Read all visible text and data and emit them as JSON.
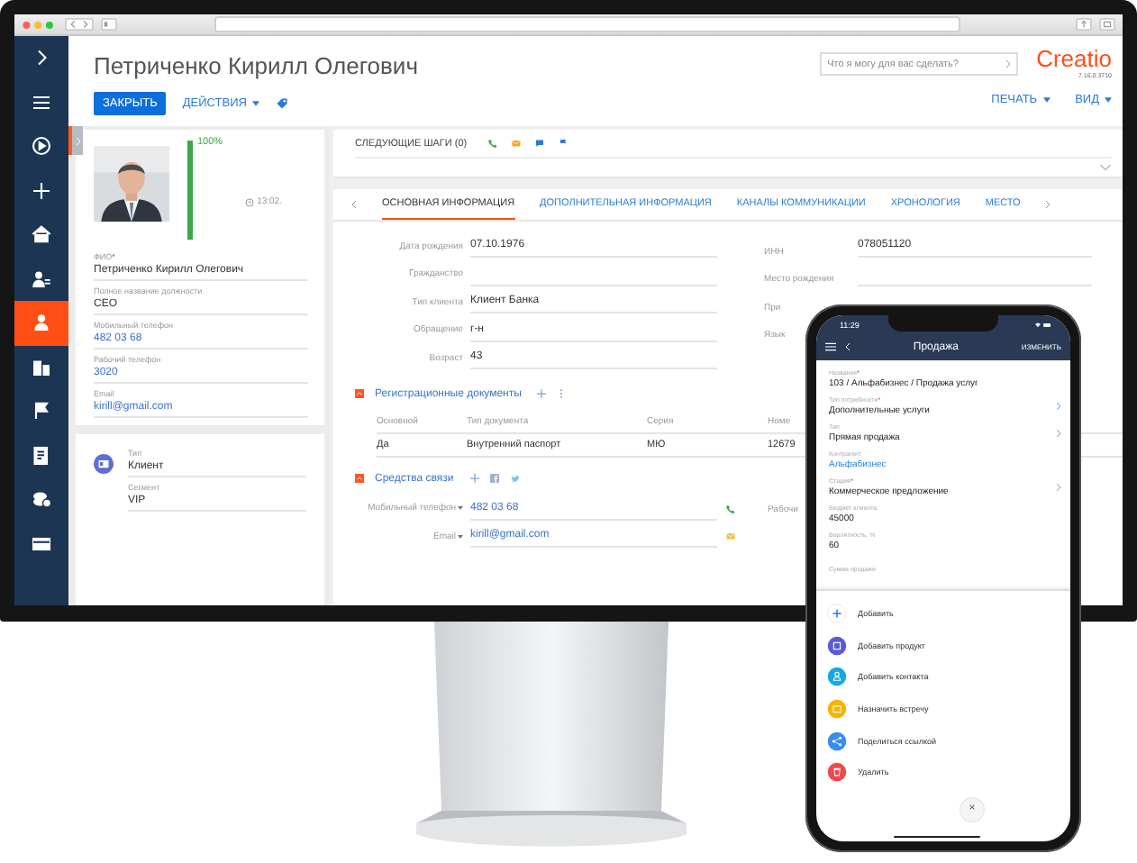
{
  "sidebar": {
    "items": [
      {
        "kind": "expand",
        "selected": false
      },
      {
        "kind": "menu",
        "selected": false
      },
      {
        "kind": "play",
        "selected": false
      },
      {
        "kind": "add",
        "selected": false
      },
      {
        "kind": "home",
        "selected": false
      },
      {
        "kind": "contacts",
        "selected": false
      },
      {
        "kind": "contact",
        "selected": true
      },
      {
        "kind": "accounts",
        "selected": false
      },
      {
        "kind": "flag",
        "selected": false
      },
      {
        "kind": "document",
        "selected": false
      },
      {
        "kind": "finance",
        "selected": false
      },
      {
        "kind": "card",
        "selected": false
      }
    ]
  },
  "header": {
    "title": "Петриченко Кирилл Олегович",
    "close_button": "ЗАКРЫТЬ",
    "actions_button": "ДЕЙСТВИЯ",
    "search": {
      "placeholder": "Что я могу для вас сделать?"
    },
    "logo": "Creatio",
    "version": "7.16.0.3710",
    "print_button": "ПЕЧАТЬ",
    "view_button": "ВИД"
  },
  "profile": {
    "completeness": {
      "label": "100%",
      "level": 1
    },
    "time": "13:02.",
    "fields": [
      {
        "label": "ФИО",
        "mark": "*",
        "value": "Петриченко Кирилл Олегович",
        "link": false
      },
      {
        "label": "Полное название должности",
        "value": "CEO",
        "link": false
      },
      {
        "label": "Мобильный телефон",
        "value": "482 03 68",
        "link": true
      },
      {
        "label": "Рабочий телефон",
        "value": "3020",
        "link": true
      },
      {
        "label": "Email",
        "value": "kirill@gmail.com",
        "link": true
      }
    ]
  },
  "type_card": {
    "fields": [
      {
        "label": "Тип",
        "value": "Клиент"
      },
      {
        "label": "Сегмент",
        "value": "VIP"
      }
    ]
  },
  "next_steps": {
    "label": "СЛЕДУЮЩИЕ ШАГИ (0)"
  },
  "tabs": [
    {
      "label": "ОСНОВНАЯ ИНФОРМАЦИЯ",
      "selected": true
    },
    {
      "label": "ДОПОЛНИТЕЛЬНАЯ ИНФОРМАЦИЯ",
      "selected": false
    },
    {
      "label": "КАНАЛЫ КОММУНИКАЦИИ",
      "selected": false
    },
    {
      "label": "ХРОНОЛОГИЯ",
      "selected": false
    },
    {
      "label": "МЕСТО",
      "selected": false
    }
  ],
  "form_left": [
    {
      "label": "Дата рождения",
      "value": "07.10.1976"
    },
    {
      "label": "Гражданство"
    },
    {
      "label": "Тип клиента",
      "value": "Клиент Банка"
    },
    {
      "label": "Обращение",
      "value": "г-н"
    },
    {
      "label": "Возраст",
      "value": "43"
    }
  ],
  "form_right": [
    {
      "kind": "field",
      "label": "ИНН",
      "value": "078051120"
    },
    {
      "kind": "field",
      "label": "Место рождения"
    },
    {
      "kind": "covered",
      "label": "При"
    },
    {
      "kind": "covered",
      "label": "Язык"
    }
  ],
  "documents": {
    "title": "Регистрационные документы",
    "columns": [
      "Основной",
      "Тип документа",
      "Серия",
      "Номе"
    ],
    "rows": [
      [
        "Да",
        "Внутренний паспорт",
        "МЮ",
        "12679"
      ]
    ]
  },
  "communications": {
    "title": "Средства связи",
    "side_label": "Рабочи",
    "rows": [
      {
        "kind": "phone",
        "label": "Мобильный телефон",
        "value": "482 03 68"
      },
      {
        "kind": "email",
        "label": "Email",
        "value": "kirill@gmail.com"
      }
    ]
  },
  "phone": {
    "time": "11:29",
    "title": "Продажа",
    "edit_button": "ИЗМЕНИТЬ",
    "fields": [
      {
        "label": "Название",
        "mark": "*",
        "value": "103 / Альфабизнес / Продажа услуг",
        "link": false,
        "chevron": false
      },
      {
        "label": "Тип потребности",
        "mark": "*",
        "value": "Дополнительные услуги",
        "link": false,
        "chevron": true
      },
      {
        "label": "Тип",
        "value": "Прямая продажа",
        "link": false,
        "chevron": true
      },
      {
        "label": "Контрагент",
        "value": "Альфабизнес",
        "link": true,
        "chevron": false
      },
      {
        "label": "Стадия",
        "mark": "*",
        "value": "Коммерческое предложение",
        "link": false,
        "chevron": true
      },
      {
        "label": "Бюджет клиента",
        "value": "45000",
        "link": false,
        "chevron": false
      },
      {
        "label": "Вероятность, %",
        "value": "60",
        "link": false,
        "chevron": false
      },
      {
        "label": "Сумма продажи",
        "chevron": false
      }
    ],
    "actions": [
      {
        "kind": "add",
        "label": "Добавить",
        "color": "#ffffff"
      },
      {
        "kind": "product",
        "label": "Добавить продукт",
        "color": "#5b5bd6"
      },
      {
        "kind": "contact",
        "label": "Добавить контакта",
        "color": "#18a6e6"
      },
      {
        "kind": "meeting",
        "label": "Назначить встречу",
        "color": "#f5b400"
      },
      {
        "kind": "share",
        "label": "Поделиться ссылкой",
        "color": "#3b8cf3"
      },
      {
        "kind": "delete",
        "label": "Удалить",
        "color": "#f2474b"
      }
    ],
    "close_button": "×"
  }
}
